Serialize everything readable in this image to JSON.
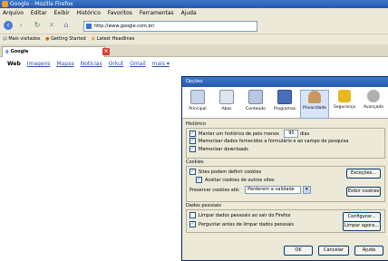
{
  "window": {
    "title": "Google - Mozilla Firefox"
  },
  "menubar": [
    "Arquivo",
    "Editar",
    "Exibir",
    "Histórico",
    "Favoritos",
    "Ferramentas",
    "Ajuda"
  ],
  "navbar": {
    "url": "http://www.google.com.br/"
  },
  "bookmarks": [
    "Mais visitados",
    "Getting Started",
    "Latest Headlines"
  ],
  "tab": {
    "label": "Google"
  },
  "google_nav": {
    "active": "Web",
    "links": [
      "Imagens",
      "Mapas",
      "Notícias",
      "Orkut",
      "Gmail",
      "mais ▾"
    ]
  },
  "dialog": {
    "title": "Opções",
    "tabs": [
      "Principal",
      "Abas",
      "Conteúdo",
      "Programas",
      "Privacidade",
      "Segurança",
      "Avançado"
    ],
    "selected_tab": "Privacidade",
    "history": {
      "heading": "Histórico",
      "keep_label": "Manter um histórico de pelo menos",
      "keep_value": "90",
      "days_label": "dias",
      "forms_label": "Memorizar dados fornecidos a formulário e ao campo de pesquisa",
      "downloads_label": "Memorizar downloads"
    },
    "cookies": {
      "heading": "Cookies",
      "allow_label": "Sites podem definir cookies",
      "exceptions_button": "Exceções...",
      "third_party_label": "Aceitar cookies de outros sites",
      "keep_label": "Preservar cookies até:",
      "keep_value": "Perderem a validade",
      "show_button": "Exibir cookies"
    },
    "private": {
      "heading": "Dados pessoais",
      "clear_on_close_label": "Limpar dados pessoais ao sair do Firefox",
      "settings_button": "Configurar...",
      "ask_label": "Perguntar antes de limpar dados pessoais",
      "clear_now_button": "Limpar agora..."
    },
    "buttons": {
      "ok": "OK",
      "cancel": "Cancelar",
      "help": "Ajuda"
    }
  },
  "colors": {
    "titlebar": "#2457b3",
    "link": "#2a4eb0",
    "dialog_bg": "#ece9d8"
  }
}
